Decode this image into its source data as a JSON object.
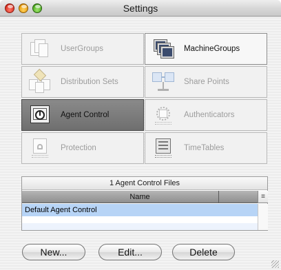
{
  "window": {
    "title": "Settings"
  },
  "categories": [
    {
      "label": "UserGroups",
      "icon": "user-groups-icon",
      "state": "disabled"
    },
    {
      "label": "MachineGroups",
      "icon": "machine-groups-icon",
      "state": "enabled"
    },
    {
      "label": "Distribution Sets",
      "icon": "distribution-sets-icon",
      "state": "disabled"
    },
    {
      "label": "Share Points",
      "icon": "share-points-icon",
      "state": "disabled"
    },
    {
      "label": "Agent Control",
      "icon": "agent-control-icon",
      "state": "selected"
    },
    {
      "label": "Authenticators",
      "icon": "authenticators-icon",
      "state": "disabled"
    },
    {
      "label": "Protection",
      "icon": "protection-icon",
      "state": "disabled"
    },
    {
      "label": "TimeTables",
      "icon": "time-tables-icon",
      "state": "enabled"
    }
  ],
  "files_table": {
    "caption": "1 Agent Control Files",
    "column_header": "Name",
    "column_menu_glyph": "≡",
    "rows": [
      "Default Agent Control"
    ]
  },
  "buttons": {
    "new": "New...",
    "edit": "Edit...",
    "delete": "Delete"
  },
  "colors": {
    "selection": "#b7d4f6",
    "selected_tile": "#7a7a7a"
  }
}
